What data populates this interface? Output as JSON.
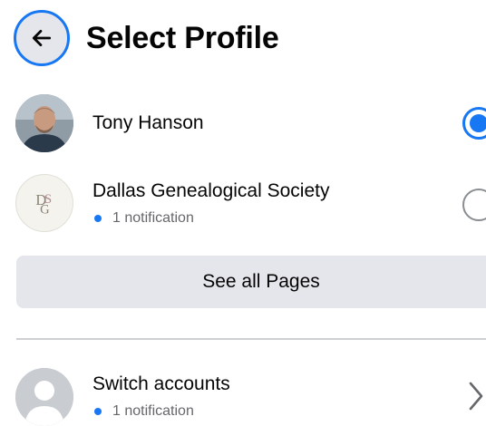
{
  "header": {
    "title": "Select Profile",
    "back_icon": "arrow-left-icon"
  },
  "profiles": [
    {
      "name": "Tony Hanson",
      "selected": true,
      "avatar": "photo"
    },
    {
      "name": "Dallas Genealogical Society",
      "notification": "1 notification",
      "selected": false,
      "avatar": "DGS monogram logo"
    }
  ],
  "see_all_label": "See all Pages",
  "switch_accounts": {
    "label": "Switch accounts",
    "notification": "1 notification",
    "icon": "chevron-right-icon"
  },
  "colors": {
    "accent": "#1877f2",
    "button_bg": "#e4e6eb",
    "secondary_text": "#65676b"
  }
}
